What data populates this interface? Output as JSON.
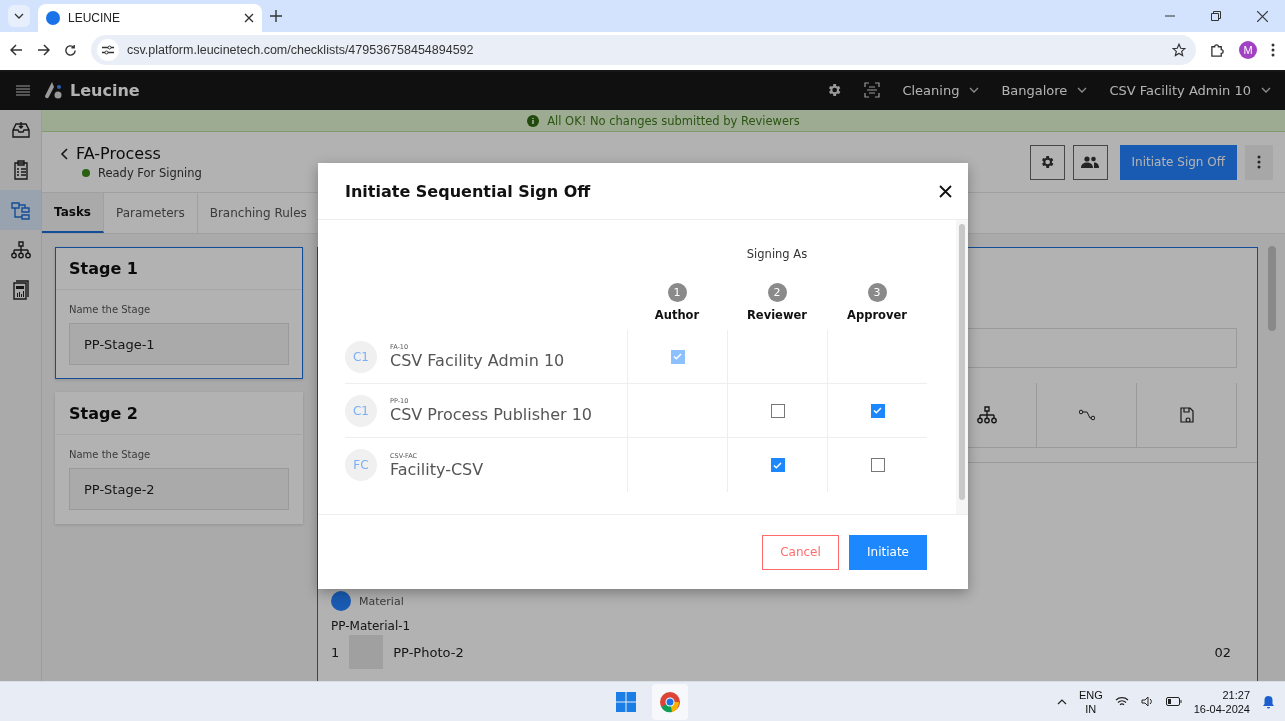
{
  "browser": {
    "tab_title": "LEUCINE",
    "url": "csv.platform.leucinetech.com/checklists/479536758454894592",
    "profile_initial": "M"
  },
  "app": {
    "brand": "Leucine",
    "menus": [
      "Cleaning",
      "Bangalore",
      "CSV Facility Admin 10"
    ]
  },
  "rail": [
    {
      "kind": "inbox",
      "selected": false
    },
    {
      "kind": "checklist",
      "selected": false
    },
    {
      "kind": "flow",
      "selected": true
    },
    {
      "kind": "hierarchy",
      "selected": false
    },
    {
      "kind": "calculator",
      "selected": false
    }
  ],
  "banner": "All OK! No changes submitted by Reviewers",
  "page": {
    "title": "FA-Process",
    "status": "Ready For Signing",
    "primary_button": "Initiate Sign Off"
  },
  "tabs": [
    {
      "label": "Tasks",
      "selected": true
    },
    {
      "label": "Parameters",
      "selected": false
    },
    {
      "label": "Branching Rules",
      "selected": false
    }
  ],
  "stages": [
    {
      "title": "Stage 1",
      "field_label": "Name the Stage",
      "value": "PP-Stage-1",
      "selected": true
    },
    {
      "title": "Stage 2",
      "field_label": "Name the Stage",
      "value": "PP-Stage-2",
      "selected": false
    }
  ],
  "task_panel": {
    "material_label": "Material",
    "material_name": "PP-Material-1",
    "items": [
      {
        "index": "1",
        "name": "PP-Photo-2",
        "count": "02"
      }
    ]
  },
  "modal": {
    "title": "Initiate Sequential Sign Off",
    "group_label": "Signing As",
    "roles": [
      {
        "number": "1",
        "name": "Author"
      },
      {
        "number": "2",
        "name": "Reviewer"
      },
      {
        "number": "3",
        "name": "Approver"
      }
    ],
    "signers": [
      {
        "initials": "C1",
        "code": "FA-10",
        "name": "CSV Facility Admin 10",
        "cells": [
          {
            "kind": "checkbox",
            "checked": true,
            "disabled": true
          },
          {
            "kind": "empty"
          },
          {
            "kind": "empty"
          }
        ]
      },
      {
        "initials": "C1",
        "code": "PP-10",
        "name": "CSV Process Publisher 10",
        "cells": [
          {
            "kind": "empty"
          },
          {
            "kind": "checkbox",
            "checked": false,
            "disabled": false
          },
          {
            "kind": "checkbox",
            "checked": true,
            "disabled": false
          }
        ]
      },
      {
        "initials": "FC",
        "code": "CSV-FAC",
        "name": "Facility-CSV",
        "cells": [
          {
            "kind": "empty"
          },
          {
            "kind": "checkbox",
            "checked": true,
            "disabled": false
          },
          {
            "kind": "checkbox",
            "checked": false,
            "disabled": false
          }
        ]
      }
    ],
    "cancel": "Cancel",
    "confirm": "Initiate"
  },
  "taskbar": {
    "language": "ENG",
    "region": "IN",
    "time": "21:27",
    "date": "16-04-2024"
  }
}
